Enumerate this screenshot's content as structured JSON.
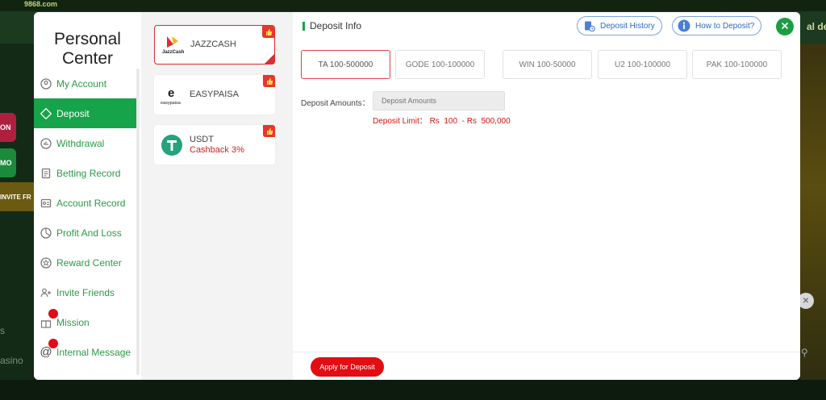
{
  "background": {
    "logo_text": "9868.com",
    "tiles": [
      "ON",
      "MO"
    ],
    "invite_text": "INVITE FR",
    "side_texts": [
      "s",
      "asino",
      "y"
    ],
    "right_text": "al dep"
  },
  "sidebar": {
    "title": "Personal Center",
    "items": [
      {
        "label": "My Account",
        "icon": "user-icon"
      },
      {
        "label": "Deposit",
        "icon": "deposit-icon"
      },
      {
        "label": "Withdrawal",
        "icon": "withdrawal-icon"
      },
      {
        "label": "Betting Record",
        "icon": "document-icon"
      },
      {
        "label": "Account Record",
        "icon": "record-icon"
      },
      {
        "label": "Profit And Loss",
        "icon": "chart-icon"
      },
      {
        "label": "Reward Center",
        "icon": "reward-icon"
      },
      {
        "label": "Invite Friends",
        "icon": "invite-icon"
      },
      {
        "label": "Mission",
        "icon": "gift-icon"
      },
      {
        "label": "Internal Message",
        "icon": "at-icon"
      }
    ]
  },
  "methods": [
    {
      "name": "JAZZCASH",
      "sub": "",
      "logo_text": "JazzCash"
    },
    {
      "name": "EASYPAISA",
      "sub": "",
      "logo_text": "easypaisa"
    },
    {
      "name": "USDT",
      "sub": "Cashback 3%",
      "logo_text": "T"
    }
  ],
  "content": {
    "title": "Deposit Info",
    "history_label": "Deposit History",
    "howto_label": "How to Deposit?",
    "channels": [
      "TA 100-500000",
      "GODE 100-100000",
      "WIN 100-50000",
      "U2 100-100000",
      "PAK 100-100000"
    ],
    "amount_label": "Deposit Amounts：",
    "amount_placeholder": "Deposit Amounts",
    "limit_text": "Deposit Limit： Rs  100  - Rs  500,000",
    "apply_label": "Apply for Deposit"
  },
  "colors": {
    "accent": "#17a34a",
    "alert": "#e30d12",
    "link": "#2f69c7"
  }
}
